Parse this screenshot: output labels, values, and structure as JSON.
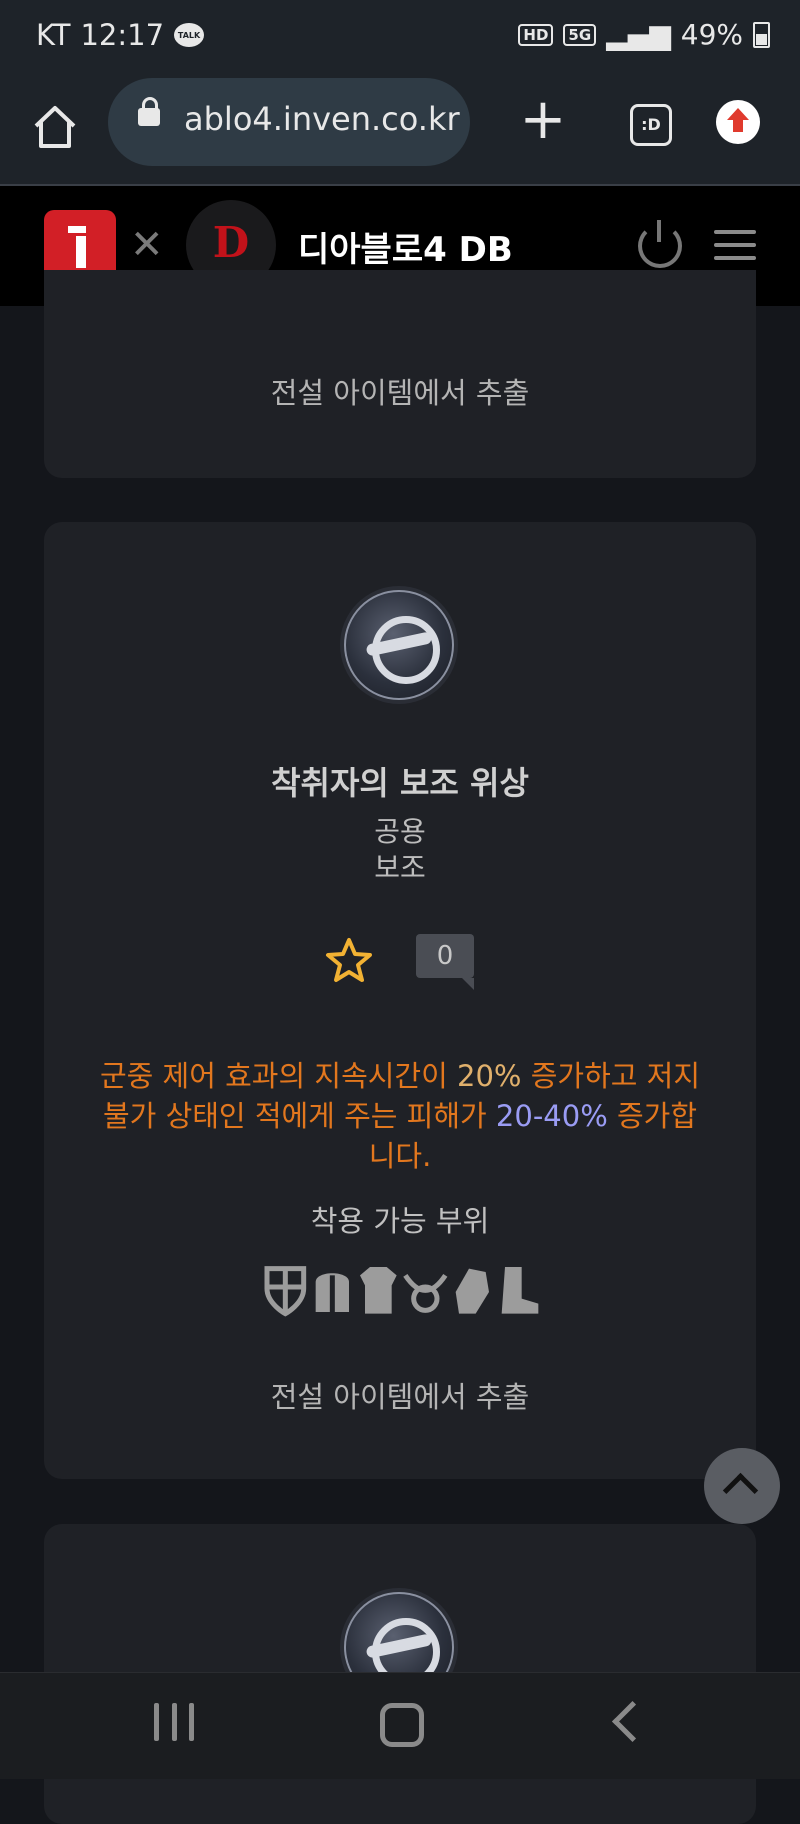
{
  "status_bar": {
    "carrier": "KT",
    "time": "12:17",
    "talk": "TALK",
    "hd": "HD",
    "net": "5G",
    "battery": "49%"
  },
  "browser": {
    "url": "ablo4.inven.co.kr",
    "tab_count_label": ":D"
  },
  "site_header": {
    "title": "디아블로4 DB"
  },
  "items": [
    {
      "source": "전설 아이템에서 추출"
    },
    {
      "name": "착취자의 보조 위상",
      "class": "공용",
      "type": "보조",
      "rating_count": "0",
      "description": {
        "p1": "군중 제어 효과의 지속시간이 ",
        "v1": "20%",
        "p2": " 증가하고 저지 불가 상태인 적에게 주는 피해가 ",
        "v2": "20-40%",
        "p3": " 증가합니다."
      },
      "slots_label": "착용 가능 부위",
      "slot_icons": [
        "shield-icon",
        "helm-icon",
        "chest-armor-icon",
        "amulet-icon",
        "gloves-icon",
        "boots-icon"
      ],
      "source": "전설 아이템에서 추출"
    }
  ],
  "colors": {
    "accent_orange": "#e2771e",
    "value_blue": "#9a9cf4",
    "star_yellow": "#f2b233",
    "brand_red": "#d21f26"
  }
}
